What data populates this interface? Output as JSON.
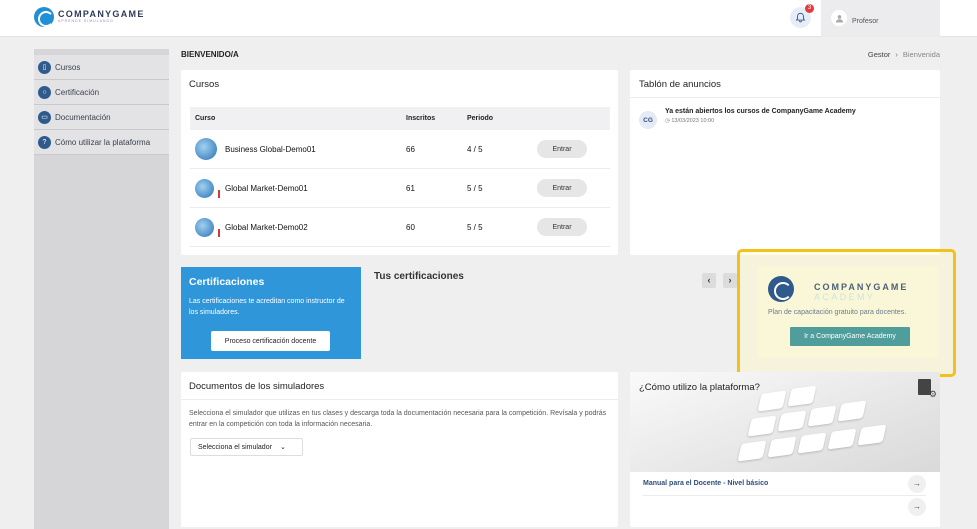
{
  "header": {
    "logo_name": "COMPANYGAME",
    "logo_tagline": "APRENDE SIMULANDO",
    "notifications_count": "3",
    "profile_label": "Profesor"
  },
  "sidebar": {
    "items": [
      {
        "label": "Cursos",
        "icon": "book-icon"
      },
      {
        "label": "Certificación",
        "icon": "award-icon"
      },
      {
        "label": "Documentación",
        "icon": "folder-icon"
      },
      {
        "label": "Cómo utilizar la plataforma",
        "icon": "help-icon"
      }
    ]
  },
  "page": {
    "welcome": "BIENVENIDO/A",
    "breadcrumb": [
      "Gestor",
      "Bienvenida"
    ]
  },
  "cursos": {
    "title": "Cursos",
    "columns": [
      "Curso",
      "Inscritos",
      "Periodo",
      ""
    ],
    "rows": [
      {
        "name": "Business Global-Demo01",
        "inscritos": "66",
        "periodo": "4 / 5",
        "action": "Entrar"
      },
      {
        "name": "Global Market-Demo01",
        "inscritos": "61",
        "periodo": "5 / 5",
        "action": "Entrar"
      },
      {
        "name": "Global Market-Demo02",
        "inscritos": "60",
        "periodo": "5 / 5",
        "action": "Entrar"
      }
    ]
  },
  "anuncios": {
    "title": "Tablón de anuncios",
    "items": [
      {
        "badge": "CG",
        "title": "Ya están abiertos los cursos de CompanyGame Academy",
        "date": "◷ 13/03/2023 10:00"
      }
    ]
  },
  "certificaciones": {
    "title": "Certificaciones",
    "text": "Las certificaciones te acreditan como instructor de los simuladores.",
    "button": "Proceso certificación docente",
    "tus_title": "Tus certificaciones",
    "prev": "‹",
    "next": "›"
  },
  "academy": {
    "name_line1": "COMPANYGAME",
    "name_line2": "ACADEMY",
    "text": "Plan de capacitación gratuito para docentes.",
    "button": "Ir a CompanyGame Academy",
    "highlight_color": "#f2c11c"
  },
  "documentos": {
    "title": "Documentos de los simuladores",
    "text": "Selecciona el simulador que utilizas en tus clases y descarga toda la documentación necesaria para la competición. Revísala y podrás entrar en la competición con toda la información necesaria.",
    "select_label": "Selecciona el simulador"
  },
  "como": {
    "title": "¿Cómo utilizo la plataforma?",
    "manual_link": "Manual para el Docente - Nivel básico",
    "arrow": "→"
  }
}
